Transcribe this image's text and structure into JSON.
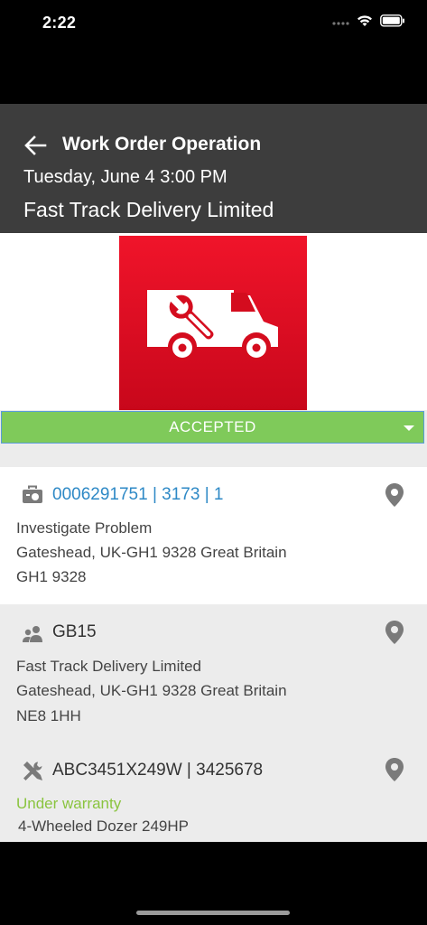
{
  "status_bar": {
    "time": "2:22"
  },
  "header": {
    "title": "Work Order Operation",
    "date": "Tuesday, June 4 3:00 PM",
    "company": "Fast Track Delivery Limited"
  },
  "status_dropdown": {
    "value": "ACCEPTED",
    "color": "#7fca5a"
  },
  "work_order": {
    "reference": "0006291751 | 3173 | 1",
    "description": "Investigate Problem",
    "address_line": "Gateshead, UK-GH1 9328 Great Britain",
    "postcode": "GH1 9328"
  },
  "customer": {
    "code": "GB15",
    "name": "Fast Track Delivery Limited",
    "address_line": "Gateshead, UK-GH1 9328 Great Britain",
    "postcode": "NE8 1HH"
  },
  "equipment": {
    "id": "ABC3451X249W | 3425678",
    "warranty": "Under warranty",
    "model": "4-Wheeled Dozer 249HP"
  },
  "icons": {
    "back": "arrow-left-icon",
    "hero": "service-van-wrench-icon",
    "work_order": "toolbox-icon",
    "customer": "people-icon",
    "equipment": "tools-icon",
    "location": "map-pin-icon"
  },
  "colors": {
    "accent_blue": "#2e89c6",
    "green": "#8ac43f",
    "brand_red": "#e0101f",
    "header": "#3d3d3d"
  }
}
